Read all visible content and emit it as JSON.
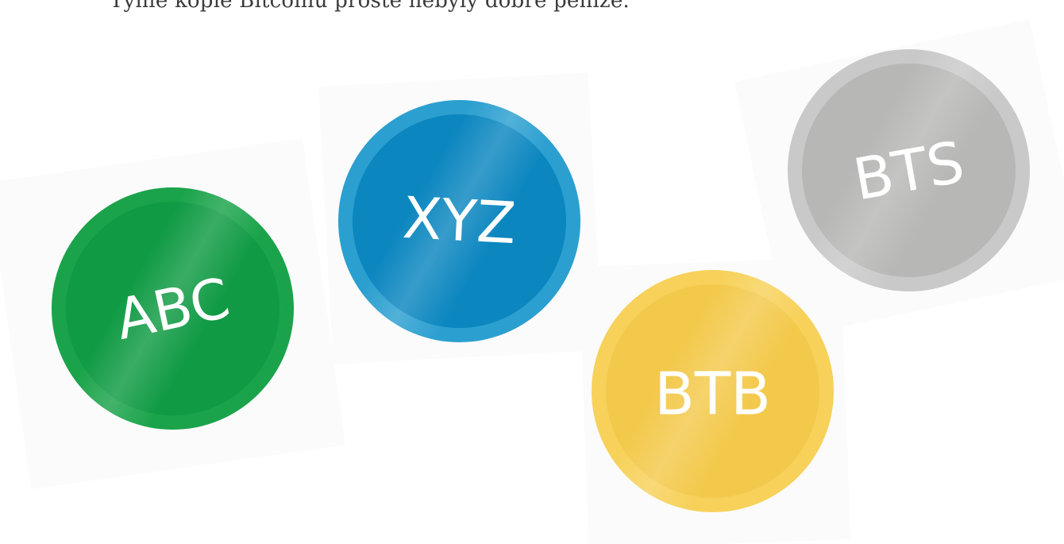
{
  "caption": "Tyhle kopie Bitcoinu prostě nebyly dobré peníze.",
  "coins": [
    {
      "id": "abc",
      "label": "ABC",
      "rim_color": "#1aa34a",
      "face_color": "#0f9a43"
    },
    {
      "id": "xyz",
      "label": "XYZ",
      "rim_color": "#2b9fd0",
      "face_color": "#0b86bf"
    },
    {
      "id": "btb",
      "label": "BTB",
      "rim_color": "#f7d15a",
      "face_color": "#f3c94b"
    },
    {
      "id": "bts",
      "label": "BTS",
      "rim_color": "#c9c9c9",
      "face_color": "#b7b7b6"
    }
  ]
}
